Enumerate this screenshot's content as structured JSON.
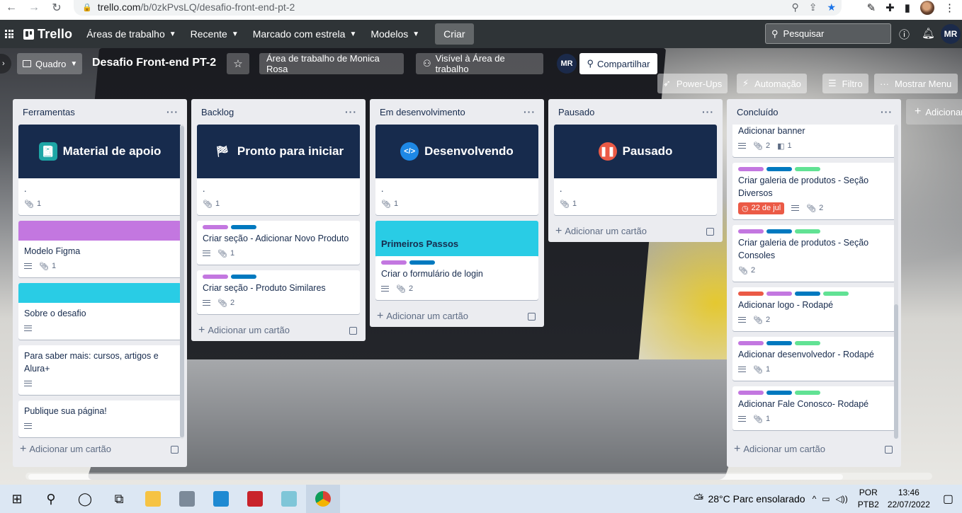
{
  "browser": {
    "url_host": "trello.com",
    "url_path": "/b/0zkPvsLQ/desafio-front-end-pt-2"
  },
  "header": {
    "logo": "Trello",
    "menu": [
      "Áreas de trabalho",
      "Recente",
      "Marcado com estrela",
      "Modelos"
    ],
    "create": "Criar",
    "search_placeholder": "Pesquisar",
    "avatar": "MR"
  },
  "board": {
    "view": "Quadro",
    "title": "Desafio Front-end PT-2",
    "workspace": "Área de trabalho de Monica Rosa",
    "visibility": "Visível à Área de trabalho",
    "member": "MR",
    "share": "Compartilhar",
    "powerups": "Power-Ups",
    "automation": "Automação",
    "filter": "Filtro",
    "show_menu": "Mostrar Menu",
    "add_list": "Adicionar outra lista"
  },
  "add_card_label": "Adicionar um cartão",
  "lists": [
    {
      "title": "Ferramentas",
      "cards": [
        {
          "cover_title": "Material de apoio",
          "title": ".",
          "attachments": "1"
        },
        {
          "color_cover": "#c377e0",
          "title": "Modelo Figma",
          "attachments": "1"
        },
        {
          "color_cover": "#29cce5",
          "title": "Sobre o desafio"
        },
        {
          "title": "Para saber mais: cursos, artigos e Alura+"
        },
        {
          "title": "Publique sua página!"
        }
      ]
    },
    {
      "title": "Backlog",
      "cards": [
        {
          "cover_title": "Pronto para iniciar",
          "title": ".",
          "attachments": "1"
        },
        {
          "title": "Criar seção - Adicionar Novo Produto",
          "attachments": "1"
        },
        {
          "title": "Criar seção - Produto Similares",
          "attachments": "2"
        }
      ]
    },
    {
      "title": "Em desenvolvimento",
      "cards": [
        {
          "cover_title": "Desenvolvendo",
          "title": ".",
          "attachments": "1"
        },
        {
          "tall_cover_title": "Primeiros Passos"
        },
        {
          "title": "Criar o formulário de login",
          "attachments": "2"
        }
      ]
    },
    {
      "title": "Pausado",
      "cards": [
        {
          "cover_title": "Pausado",
          "title": ".",
          "attachments": "1"
        }
      ]
    },
    {
      "title": "Concluído",
      "cards": [
        {
          "title": "Adicionar banner",
          "attachments": "2",
          "checklist": "1"
        },
        {
          "title": "Criar galeria de produtos - Seção Diversos",
          "due": "22 de jul",
          "attachments": "2"
        },
        {
          "title": "Criar galeria de produtos - Seção Consoles",
          "attachments": "2"
        },
        {
          "title": "Adicionar logo - Rodapé",
          "attachments": "2"
        },
        {
          "title": "Adicionar desenvolvedor - Rodapé",
          "attachments": "1"
        },
        {
          "title": "Adicionar Fale Conosco- Rodapé",
          "attachments": "1"
        }
      ]
    }
  ],
  "colors": {
    "label_purple": "#c377e0",
    "label_blue": "#0079bf",
    "label_green": "#61e294",
    "label_red": "#eb5a46",
    "cover_dark": "#172b4d",
    "cover_cyan": "#29cce5"
  },
  "taskbar": {
    "weather": "28°C  Parc ensolarado",
    "lang_top": "POR",
    "lang_bottom": "PTB2",
    "time": "13:46",
    "date": "22/07/2022"
  }
}
